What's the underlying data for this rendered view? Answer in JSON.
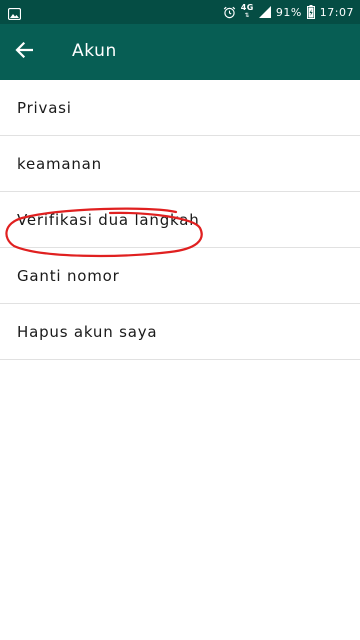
{
  "status_bar": {
    "network": "4G",
    "battery": "91%",
    "time": "17:07",
    "icons": [
      "image-icon",
      "alarm-icon",
      "signal-icon",
      "battery-icon"
    ]
  },
  "app_bar": {
    "title": "Akun",
    "back_icon": "arrow-back-icon",
    "color": "#075e54",
    "status_color": "#054d44"
  },
  "menu": {
    "items": [
      {
        "label": "Privasi"
      },
      {
        "label": "keamanan"
      },
      {
        "label": "Verifikasi dua langkah",
        "highlighted": true
      },
      {
        "label": "Ganti nomor"
      },
      {
        "label": "Hapus akun saya"
      }
    ]
  },
  "annotation": {
    "shape": "hand-drawn ellipse",
    "color": "#e02020",
    "target": "Verifikasi dua langkah"
  }
}
